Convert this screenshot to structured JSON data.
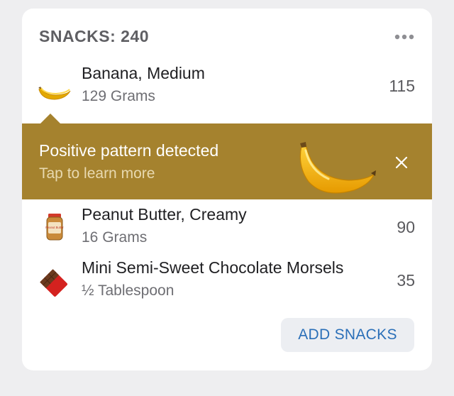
{
  "snacks": {
    "title": "SNACKS: 240",
    "more_icon": "more-dots-icon",
    "items": [
      {
        "name": "Banana, Medium",
        "amount": "129 Grams",
        "calories": "115",
        "icon": "banana-icon"
      },
      {
        "name": "Peanut Butter, Creamy",
        "amount": "16 Grams",
        "calories": "90",
        "icon": "peanut-butter-jar-icon"
      },
      {
        "name": "Mini Semi-Sweet Chocolate Morsels",
        "amount": "½ Tablespoon",
        "calories": "35",
        "icon": "chocolate-bar-icon"
      }
    ],
    "add_button_label": "ADD SNACKS"
  },
  "banner": {
    "title": "Positive pattern detected",
    "subtitle": "Tap to learn more",
    "close_icon": "close-icon",
    "illustration": "banana-illustration",
    "color": "#a5822e"
  },
  "peanut_butter_label": "Peanut Butter"
}
